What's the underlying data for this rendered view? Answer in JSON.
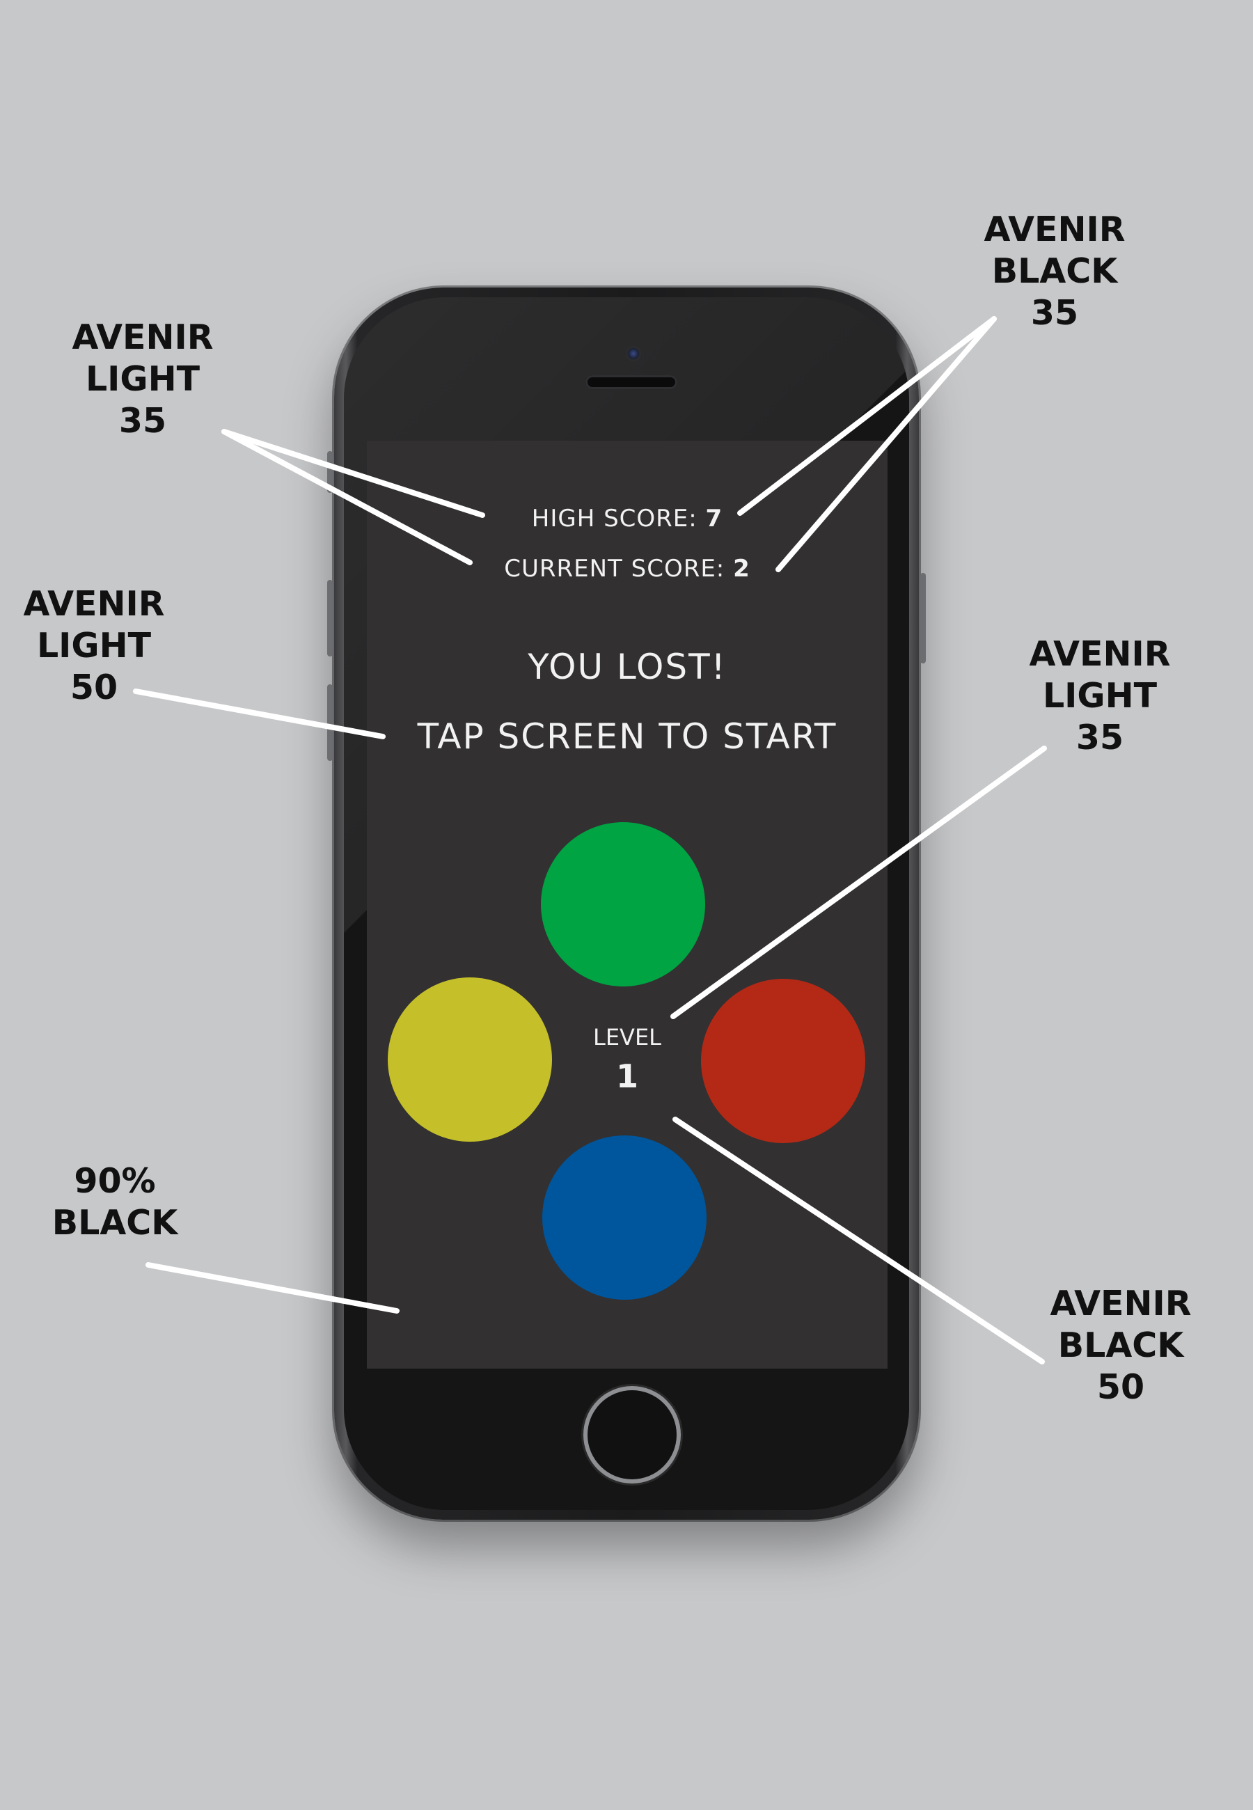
{
  "annotations": {
    "high_score_font": [
      "AVENIR",
      "LIGHT",
      "35"
    ],
    "score_value_font": [
      "AVENIR",
      "BLACK",
      "35"
    ],
    "message_font": [
      "AVENIR",
      "LIGHT",
      "50"
    ],
    "level_label_font": [
      "AVENIR",
      "LIGHT",
      "35"
    ],
    "background_color": [
      "90%",
      "BLACK"
    ],
    "level_value_font": [
      "AVENIR",
      "BLACK",
      "50"
    ]
  },
  "game": {
    "high_score_label": "HIGH SCORE:",
    "high_score_value": "7",
    "current_score_label": "CURRENT SCORE:",
    "current_score_value": "2",
    "lost_message": "YOU LOST!",
    "start_prompt": "TAP SCREEN TO START",
    "level_label": "LEVEL",
    "level_value": "1"
  },
  "colors": {
    "background": "#c7c8ca",
    "screen": "#323031",
    "green": "#00a443",
    "yellow": "#c5c02a",
    "red": "#b42916",
    "blue": "#00569c",
    "leader_lines": "#ffffff"
  }
}
